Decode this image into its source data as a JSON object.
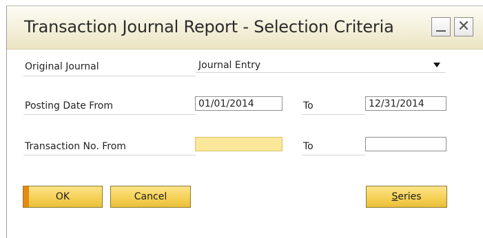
{
  "window": {
    "title": "Transaction Journal Report - Selection Criteria"
  },
  "form": {
    "original_journal": {
      "label": "Original Journal",
      "value": "Journal Entry"
    },
    "posting_date": {
      "label": "Posting Date From",
      "from_value": "01/01/2014",
      "to_label": "To",
      "to_value": "12/31/2014"
    },
    "transaction_no": {
      "label": "Transaction No. From",
      "from_value": "",
      "to_label": "To",
      "to_value": ""
    }
  },
  "buttons": {
    "ok": "OK",
    "cancel": "Cancel",
    "series_first": "S",
    "series_rest": "eries"
  },
  "colors": {
    "button_yellow": "#f5cf52",
    "active_field": "#fbe79a",
    "ok_accent": "#e58a12"
  }
}
